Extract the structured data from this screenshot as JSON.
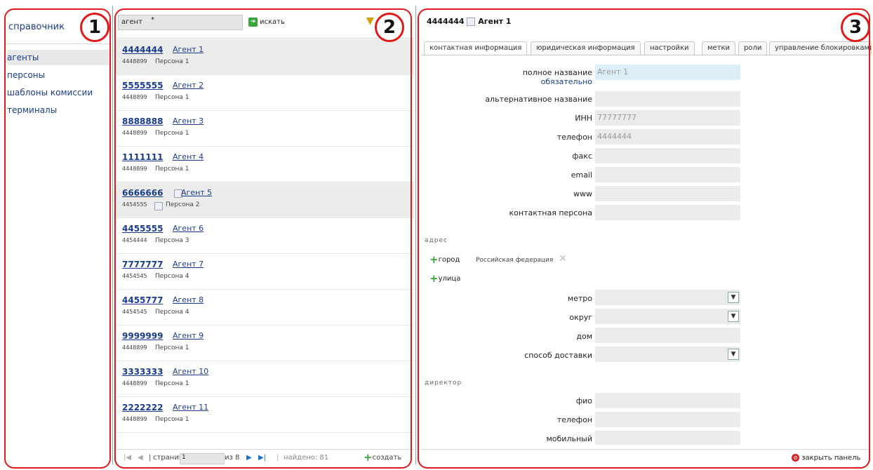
{
  "panel1": {
    "title": "справочник",
    "items": [
      {
        "label": "агенты"
      },
      {
        "label": "персоны"
      },
      {
        "label": "шаблоны комиссии"
      },
      {
        "label": "терминалы"
      }
    ]
  },
  "panel2": {
    "search_label": "агент",
    "search_value": "*",
    "search_button": "искать",
    "agents": [
      {
        "code": "4444444",
        "name": "Агент 1",
        "sub_code": "4448899",
        "sub_name": "Персона 1"
      },
      {
        "code": "5555555",
        "name": "Агент 2",
        "sub_code": "4448899",
        "sub_name": "Персона 1"
      },
      {
        "code": "8888888",
        "name": "Агент 3",
        "sub_code": "4448899",
        "sub_name": "Персона 1"
      },
      {
        "code": "1111111",
        "name": "Агент 4",
        "sub_code": "4448899",
        "sub_name": "Персона 1"
      },
      {
        "code": "6666666",
        "name": "Агент 5",
        "sub_code": "4454555",
        "sub_name": "Персона 2"
      },
      {
        "code": "4455555",
        "name": "Агент 6",
        "sub_code": "4454444",
        "sub_name": "Персона 3"
      },
      {
        "code": "7777777",
        "name": "Агент 7",
        "sub_code": "4454545",
        "sub_name": "Персона 4"
      },
      {
        "code": "4455777",
        "name": "Агент 8",
        "sub_code": "4454545",
        "sub_name": "Персона 4"
      },
      {
        "code": "9999999",
        "name": "Агент 9",
        "sub_code": "4448899",
        "sub_name": "Персона 1"
      },
      {
        "code": "3333333",
        "name": "Агент 10",
        "sub_code": "4448899",
        "sub_name": "Персона 1"
      },
      {
        "code": "2222222",
        "name": "Агент 11",
        "sub_code": "4448899",
        "sub_name": "Персона 1"
      }
    ],
    "pager": {
      "page_label": "страница",
      "page_value": "1",
      "of_label": "из 8",
      "found": "найдено: 81",
      "create": "создать"
    }
  },
  "panel3": {
    "header_code": "4444444",
    "header_name": "Агент 1",
    "tabs": [
      {
        "label": "контактная информация"
      },
      {
        "label": "юридическая информация"
      },
      {
        "label": "настройки"
      },
      {
        "label": "метки"
      },
      {
        "label": "роли"
      },
      {
        "label": "управление блокировками"
      }
    ],
    "fields": {
      "full_name_label": "полное название",
      "required_label": "обязательно",
      "full_name_value": "Агент 1",
      "alt_name_label": "альтернативное название",
      "inn_label": "ИНН",
      "inn_value": "77777777",
      "phone_label": "телефон",
      "phone_value": "4444444",
      "fax_label": "факс",
      "email_label": "email",
      "www_label": "www",
      "contact_label": "контактная персона"
    },
    "address": {
      "section": "адрес",
      "city_label": "город",
      "country_value": "Российская федерация",
      "street_label": "улица",
      "metro_label": "метро",
      "district_label": "округ",
      "house_label": "дом",
      "delivery_label": "способ доставки"
    },
    "director": {
      "section": "директор",
      "fio_label": "фио",
      "phone_label": "телефон",
      "mobile_label": "мобильный"
    },
    "close_panel": "закрыть панель"
  },
  "badges": [
    "1",
    "2",
    "3"
  ],
  "colors": {
    "callout": "#e01a1a",
    "link": "#1a3c8e",
    "required_field": "#dceef7",
    "selected_row": "#ececec"
  }
}
